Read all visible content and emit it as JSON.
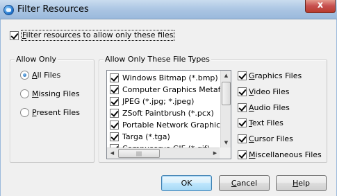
{
  "window": {
    "title": "Filter Resources",
    "close_symbol": "x"
  },
  "filter_toggle": {
    "label_underlined": "F",
    "label_rest": "ilter resources to allow only these files",
    "checked": true
  },
  "allow_only": {
    "title": "Allow Only",
    "options": [
      {
        "u": "A",
        "rest": "ll Files",
        "selected": true
      },
      {
        "u": "M",
        "rest": "issing Files",
        "selected": false
      },
      {
        "u": "P",
        "rest": "resent Files",
        "selected": false
      }
    ]
  },
  "file_types": {
    "title": "Allow Only These File Types",
    "items": [
      {
        "label": "Windows Bitmap (*.bmp)",
        "checked": true
      },
      {
        "label": "Computer Graphics Metafile (*.",
        "checked": true
      },
      {
        "label": "JPEG (*.jpg; *.jpeg)",
        "checked": true
      },
      {
        "label": "ZSoft Paintbrush (*.pcx)",
        "checked": true
      },
      {
        "label": "Portable Network Graphics (*.",
        "checked": true
      },
      {
        "label": "Targa (*.tga)",
        "checked": true
      },
      {
        "label": "Compuserve GIF (*.gif)",
        "checked": true
      }
    ],
    "categories": [
      {
        "u": "G",
        "rest": "raphics Files",
        "checked": true
      },
      {
        "u": "V",
        "rest": "ideo Files",
        "checked": true
      },
      {
        "u": "A",
        "rest": "udio Files",
        "checked": true
      },
      {
        "u": "T",
        "rest": "ext Files",
        "checked": true
      },
      {
        "u": "C",
        "rest": "ursor Files",
        "checked": true
      },
      {
        "u": "M",
        "rest": "iscellaneous Files",
        "checked": true
      }
    ]
  },
  "buttons": {
    "ok": "OK",
    "cancel_u": "C",
    "cancel_rest": "ancel",
    "help_u": "H",
    "help_rest": "elp"
  },
  "icons": {
    "window": "app-globe-icon",
    "scroll_up": "▲",
    "scroll_down": "▼",
    "scroll_left": "◀",
    "scroll_right": "▶"
  }
}
